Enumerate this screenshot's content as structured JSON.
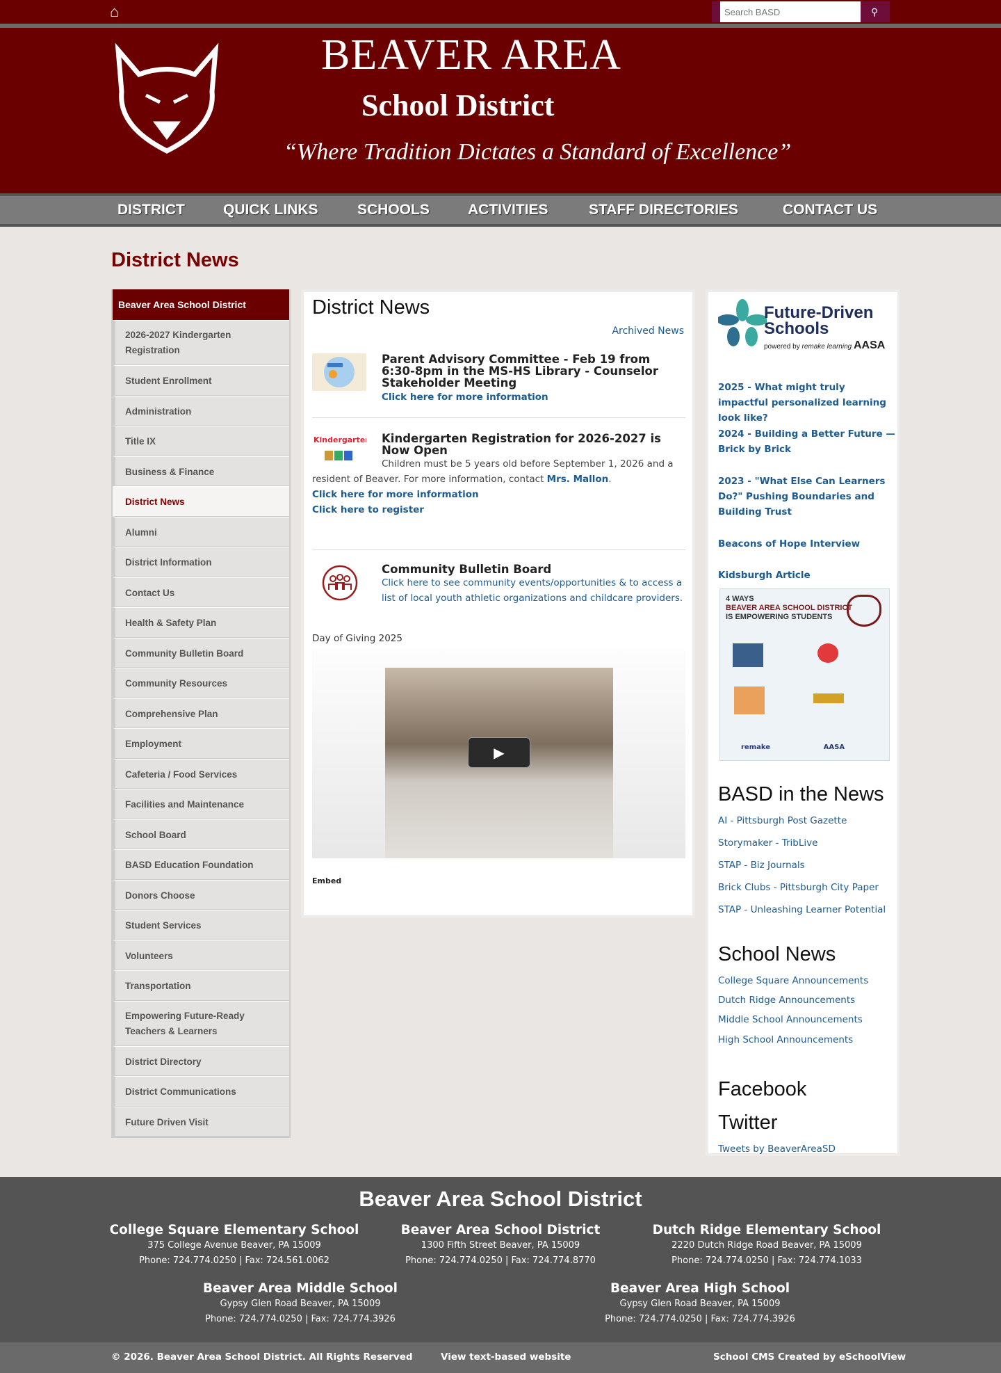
{
  "topbar": {
    "search_placeholder": "Search BASD"
  },
  "header": {
    "title": "BEAVER AREA",
    "subtitle": "School District",
    "motto": "“Where Tradition Dictates a Standard of Excellence”"
  },
  "nav": [
    "DISTRICT",
    "QUICK LINKS",
    "SCHOOLS",
    "ACTIVITIES",
    "STAFF DIRECTORIES",
    "CONTACT US"
  ],
  "page_title": "District News",
  "sidebar": {
    "header": "Beaver Area School District",
    "items": [
      "2026-2027 Kindergarten Registration",
      "Student Enrollment",
      "Administration",
      "Title IX",
      "Business & Finance",
      "District News",
      "Alumni",
      "District Information",
      "Contact Us",
      "Health & Safety Plan",
      "Community Bulletin Board",
      "Community Resources",
      "Comprehensive Plan",
      "Employment",
      "Cafeteria / Food Services",
      "Facilities and Maintenance",
      "School Board",
      "BASD Education Foundation",
      "Donors Choose",
      "Student Services",
      "Volunteers",
      "Transportation",
      "Empowering Future-Ready Teachers & Learners",
      "District Directory",
      "District Communications",
      "Future Driven Visit"
    ]
  },
  "main": {
    "heading": "District News",
    "archived": "Archived News",
    "news1": {
      "title": "Parent Advisory Committee - Feb 19 from 6:30-8pm in the MS-HS Library - Counselor Stakeholder Meeting",
      "link": "Click here for more information"
    },
    "news2": {
      "title": "Kindergarten Registration for 2026-2027 is Now Open",
      "body": "Children must be 5 years old before September 1, 2026 and a resident of Beaver. For more information, contact ",
      "contact": "Mrs. Mallon",
      "link1": "Click here for more information",
      "link2": "Click here to register"
    },
    "news3": {
      "title": "Community Bulletin Board",
      "body": "Click here to see community events/opportunities & to access a list of local youth athletic organizations and childcare providers."
    },
    "video_caption": "Day of Giving 2025",
    "embed": "Embed"
  },
  "right": {
    "logo": "Future-Driven Schools powered by remake learning AASA",
    "links": [
      "2025 - What might truly impactful personalized learning look like?",
      "2024 - Building a Better Future — Brick by Brick",
      "2023 - \"What Else Can Learners Do?\" Pushing Boundaries and Building Trust",
      "Beacons of Hope Interview",
      "Kidsburgh Article"
    ],
    "infographic": {
      "line1": "4 WAYS",
      "line2": "BEAVER AREA SCHOOL DISTRICT",
      "line3": "IS EMPOWERING STUDENTS"
    },
    "basd_heading": "BASD in the News",
    "basd_links": [
      "AI - Pittsburgh Post Gazette",
      "Storymaker - TribLive",
      "STAP - Biz Journals",
      "Brick Clubs - Pittsburgh City Paper",
      "STAP - Unleashing Learner Potential"
    ],
    "school_heading": "School News",
    "school_links": [
      "College Square Announcements",
      "Dutch Ridge Announcements",
      "Middle School Announcements",
      "High School Announcements"
    ],
    "facebook": "Facebook",
    "twitter": "Twitter",
    "tweets": "Tweets by BeaverAreaSD"
  },
  "footer": {
    "title": "Beaver Area School District",
    "schools": [
      {
        "name": "College Square Elementary School",
        "addr": "375 College Avenue Beaver, PA 15009",
        "phone": "Phone: 724.774.0250 | Fax: 724.561.0062"
      },
      {
        "name": "Beaver Area School District",
        "addr": "1300 Fifth Street Beaver, PA 15009",
        "phone": "Phone: 724.774.0250 | Fax: 724.774.8770"
      },
      {
        "name": "Dutch Ridge Elementary School",
        "addr": "2220 Dutch Ridge Road Beaver, PA 15009",
        "phone": "Phone: 724.774.0250 | Fax: 724.774.1033"
      },
      {
        "name": "Beaver Area Middle School",
        "addr": "Gypsy Glen Road Beaver, PA 15009",
        "phone": "Phone: 724.774.0250 | Fax: 724.774.3926"
      },
      {
        "name": "Beaver Area High School",
        "addr": "Gypsy Glen Road Beaver, PA 15009",
        "phone": "Phone: 724.774.0250 | Fax: 724.774.3926"
      }
    ],
    "copyright": "© 2026. Beaver Area School District. All Rights Reserved",
    "text_site": "View text-based website",
    "cms": "School CMS Created by eSchoolView"
  }
}
